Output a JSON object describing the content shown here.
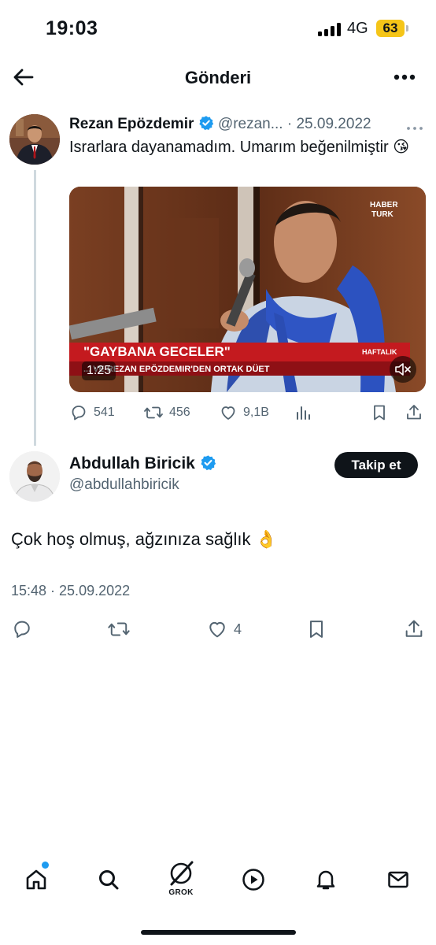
{
  "status_bar": {
    "time": "19:03",
    "network": "4G",
    "battery": "63"
  },
  "header": {
    "title": "Gönderi"
  },
  "parent_tweet": {
    "author_name": "Rezan Epözdemir",
    "handle": "@rezan...",
    "separator": "·",
    "date": "25.09.2022",
    "text": "Israrlara dayanamadım. Umarım beğenilmiştir 😘",
    "media": {
      "channel_logo_line1": "HABER",
      "channel_logo_line2": "TURK",
      "banner_title": "\"GAYBANA GECELER\"",
      "banner_tag": "HAFTALIK",
      "banner_subtitle": "... VE REZAN EPÖZDEMIR'DEN ORTAK DÜET",
      "duration": "1:25"
    },
    "stats": {
      "replies": "541",
      "reposts": "456",
      "likes": "9,1B"
    }
  },
  "reply_tweet": {
    "author_name": "Abdullah Biricik",
    "handle": "@abdullahbiricik",
    "follow_label": "Takip et",
    "text": "Çok hoş olmuş, ağzınıza sağlık 👌",
    "timestamp": "15:48 · 25.09.2022",
    "likes": "4"
  },
  "bottom_nav": {
    "grok_label": "GROK"
  },
  "colors": {
    "verified_blue": "#1d9bf0",
    "secondary_text": "#536471",
    "primary_text": "#0f1419",
    "battery_yellow": "#f5c518"
  }
}
